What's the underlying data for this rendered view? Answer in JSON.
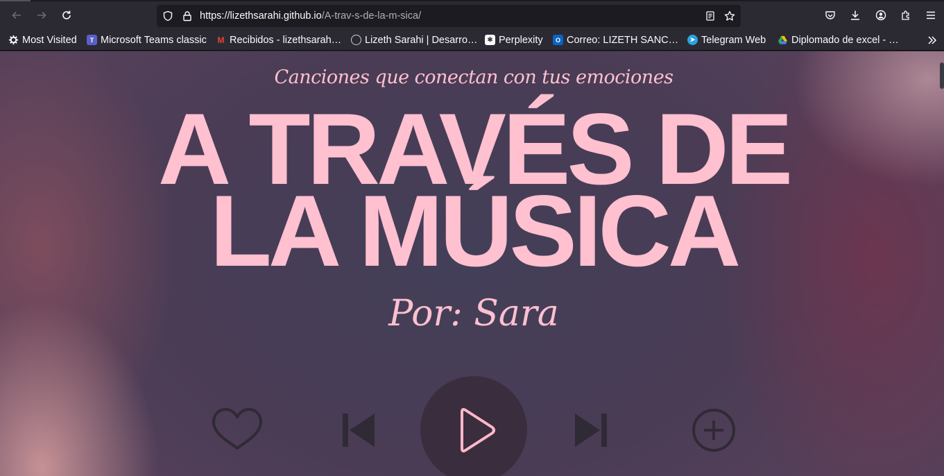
{
  "browser": {
    "url_host": "https://lizethsarahi.github.io",
    "url_path": "/A-trav-s-de-la-m-sica/",
    "bookmarks": [
      {
        "label": "Most Visited",
        "icon": "gear-icon"
      },
      {
        "label": "Microsoft Teams classic",
        "icon": "teams-icon"
      },
      {
        "label": "Recibidos - lizethsarah…",
        "icon": "gmail-icon"
      },
      {
        "label": "Lizeth Sarahi | Desarro…",
        "icon": "site-icon"
      },
      {
        "label": "Perplexity",
        "icon": "perplexity-icon"
      },
      {
        "label": "Correo: LIZETH SANC…",
        "icon": "outlook-icon"
      },
      {
        "label": "Telegram Web",
        "icon": "telegram-icon"
      },
      {
        "label": "Diplomado de excel - …",
        "icon": "drive-icon"
      }
    ]
  },
  "page": {
    "subtitle": "Canciones que conectan con tus emociones",
    "title_line1": "A TRAVÉS DE",
    "title_line2": "LA MÚSICA",
    "byline": "Por: Sara",
    "controls": [
      "heart-icon",
      "previous-icon",
      "play-icon",
      "next-icon",
      "add-icon"
    ]
  },
  "colors": {
    "accent_pink": "#ffc0d0",
    "control_dark": "#2f2a35",
    "chrome_bg": "#2b2a33"
  }
}
